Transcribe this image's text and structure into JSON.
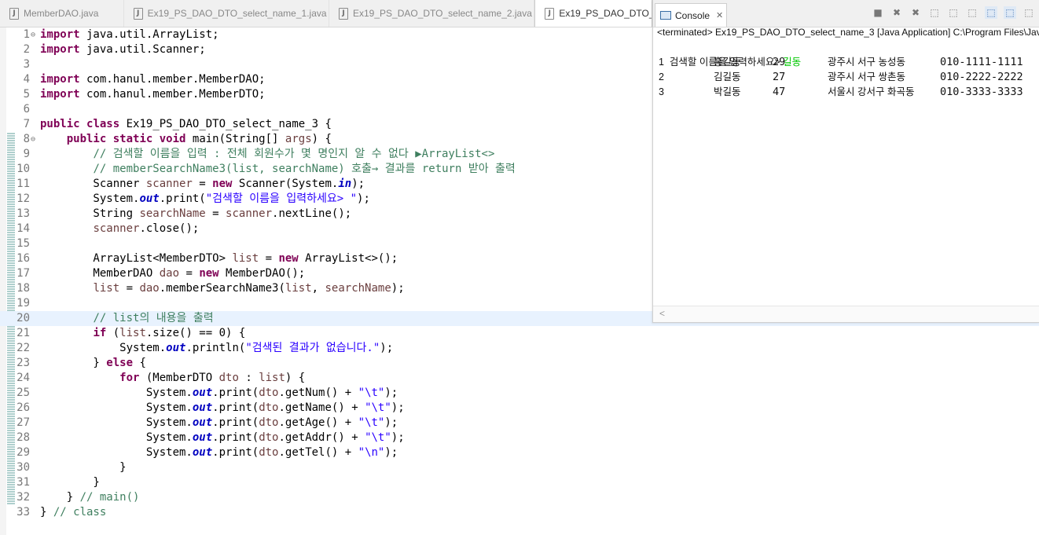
{
  "editor_tabs": [
    {
      "label": "MemberDAO.java"
    },
    {
      "label": "Ex19_PS_DAO_DTO_select_name_1.java"
    },
    {
      "label": "Ex19_PS_DAO_DTO_select_name_2.java"
    },
    {
      "label": "Ex19_PS_DAO_DTO_sele"
    }
  ],
  "code_lines": [
    {
      "n": "1",
      "fold": "⊖",
      "html": "<span class=\"kw\">import</span> java.util.ArrayList;"
    },
    {
      "n": "2",
      "fold": "",
      "html": "<span class=\"kw\">import</span> java.util.Scanner;"
    },
    {
      "n": "3",
      "fold": "",
      "html": ""
    },
    {
      "n": "4",
      "fold": "",
      "html": "<span class=\"kw\">import</span> com.hanul.member.MemberDAO;"
    },
    {
      "n": "5",
      "fold": "",
      "html": "<span class=\"kw\">import</span> com.hanul.member.MemberDTO;"
    },
    {
      "n": "6",
      "fold": "",
      "html": ""
    },
    {
      "n": "7",
      "fold": "",
      "html": "<span class=\"kw\">public</span> <span class=\"kw\">class</span> Ex19_PS_DAO_DTO_select_name_3 {"
    },
    {
      "n": "8",
      "fold": "⊖",
      "html": "    <span class=\"kw\">public</span> <span class=\"kw\">static</span> <span class=\"kw\">void</span> main(String[] <span class=\"vr\">args</span>) {"
    },
    {
      "n": "9",
      "fold": "",
      "html": "        <span class=\"cm\">// 검색할 이름을 입력 : 전체 회원수가 몇 명인지 알 수 없다 ▶ArrayList&lt;&gt;</span>"
    },
    {
      "n": "10",
      "fold": "",
      "html": "        <span class=\"cm\">// memberSearchName3(list, searchName) 호출→ 결과를 return 받아 출력</span>"
    },
    {
      "n": "11",
      "fold": "",
      "html": "        Scanner <span class=\"vr\">scanner</span> = <span class=\"kw\">new</span> Scanner(System.<span class=\"fd\">in</span>);"
    },
    {
      "n": "12",
      "fold": "",
      "html": "        System.<span class=\"fd\">out</span>.print(<span class=\"st\">\"검색할 이름을 입력하세요> \"</span>);"
    },
    {
      "n": "13",
      "fold": "",
      "html": "        String <span class=\"vr\">searchName</span> = <span class=\"vr\">scanner</span>.nextLine();"
    },
    {
      "n": "14",
      "fold": "",
      "html": "        <span class=\"vr\">scanner</span>.close();"
    },
    {
      "n": "15",
      "fold": "",
      "html": ""
    },
    {
      "n": "16",
      "fold": "",
      "html": "        ArrayList&lt;MemberDTO&gt; <span class=\"vr\">list</span> = <span class=\"kw\">new</span> ArrayList&lt;&gt;();"
    },
    {
      "n": "17",
      "fold": "",
      "html": "        MemberDAO <span class=\"vr\">dao</span> = <span class=\"kw\">new</span> MemberDAO();"
    },
    {
      "n": "18",
      "fold": "",
      "html": "        <span class=\"vr\">list</span> = <span class=\"vr\">dao</span>.memberSearchName3(<span class=\"vr\">list</span>, <span class=\"vr\">searchName</span>);"
    },
    {
      "n": "19",
      "fold": "",
      "html": ""
    },
    {
      "n": "20",
      "fold": "",
      "html": "        <span class=\"cm\">// list의 내용을 출력</span>"
    },
    {
      "n": "21",
      "fold": "",
      "html": "        <span class=\"kw\">if</span> (<span class=\"vr\">list</span>.size() == 0) {"
    },
    {
      "n": "22",
      "fold": "",
      "html": "            System.<span class=\"fd\">out</span>.println(<span class=\"st\">\"검색된 결과가 없습니다.\"</span>);"
    },
    {
      "n": "23",
      "fold": "",
      "html": "        } <span class=\"kw\">else</span> {"
    },
    {
      "n": "24",
      "fold": "",
      "html": "            <span class=\"kw\">for</span> (MemberDTO <span class=\"vr\">dto</span> : <span class=\"vr\">list</span>) {"
    },
    {
      "n": "25",
      "fold": "",
      "html": "                System.<span class=\"fd\">out</span>.print(<span class=\"vr\">dto</span>.getNum() + <span class=\"st\">\"\\t\"</span>);"
    },
    {
      "n": "26",
      "fold": "",
      "html": "                System.<span class=\"fd\">out</span>.print(<span class=\"vr\">dto</span>.getName() + <span class=\"st\">\"\\t\"</span>);"
    },
    {
      "n": "27",
      "fold": "",
      "html": "                System.<span class=\"fd\">out</span>.print(<span class=\"vr\">dto</span>.getAge() + <span class=\"st\">\"\\t\"</span>);"
    },
    {
      "n": "28",
      "fold": "",
      "html": "                System.<span class=\"fd\">out</span>.print(<span class=\"vr\">dto</span>.getAddr() + <span class=\"st\">\"\\t\"</span>);"
    },
    {
      "n": "29",
      "fold": "",
      "html": "                System.<span class=\"fd\">out</span>.print(<span class=\"vr\">dto</span>.getTel() + <span class=\"st\">\"\\n\"</span>);"
    },
    {
      "n": "30",
      "fold": "",
      "html": "            }"
    },
    {
      "n": "31",
      "fold": "",
      "html": "        }"
    },
    {
      "n": "32",
      "fold": "",
      "html": "    } <span class=\"cm\">// main()</span>"
    },
    {
      "n": "33",
      "fold": "",
      "html": "} <span class=\"cm\">// class</span>"
    }
  ],
  "console": {
    "tab_label": "Console",
    "close_glyph": "✕",
    "status": "<terminated> Ex19_PS_DAO_DTO_select_name_3 [Java Application] C:\\Program Files\\Java",
    "prompt": "검색할 이름을 입력하세요> ",
    "user_input": "길동",
    "results": [
      {
        "num": "1",
        "name": "홍길동",
        "age": "29",
        "addr": "광주시 서구 농성동",
        "tel": "010-1111-1111"
      },
      {
        "num": "2",
        "name": "김길동",
        "age": "27",
        "addr": "광주시 서구 쌍촌동",
        "tel": "010-2222-2222"
      },
      {
        "num": "3",
        "name": "박길동",
        "age": "47",
        "addr": "서울시 강서구 화곡동",
        "tel": "010-3333-3333"
      }
    ],
    "toolbar_icons": [
      "terminate-icon",
      "remove-launch-icon",
      "remove-all-icon",
      "scroll-lock-icon",
      "word-wrap-icon",
      "show-on-output-icon",
      "show-on-error-icon",
      "pin-console-icon",
      "open-console-icon"
    ],
    "scroll_left_glyph": "<"
  }
}
